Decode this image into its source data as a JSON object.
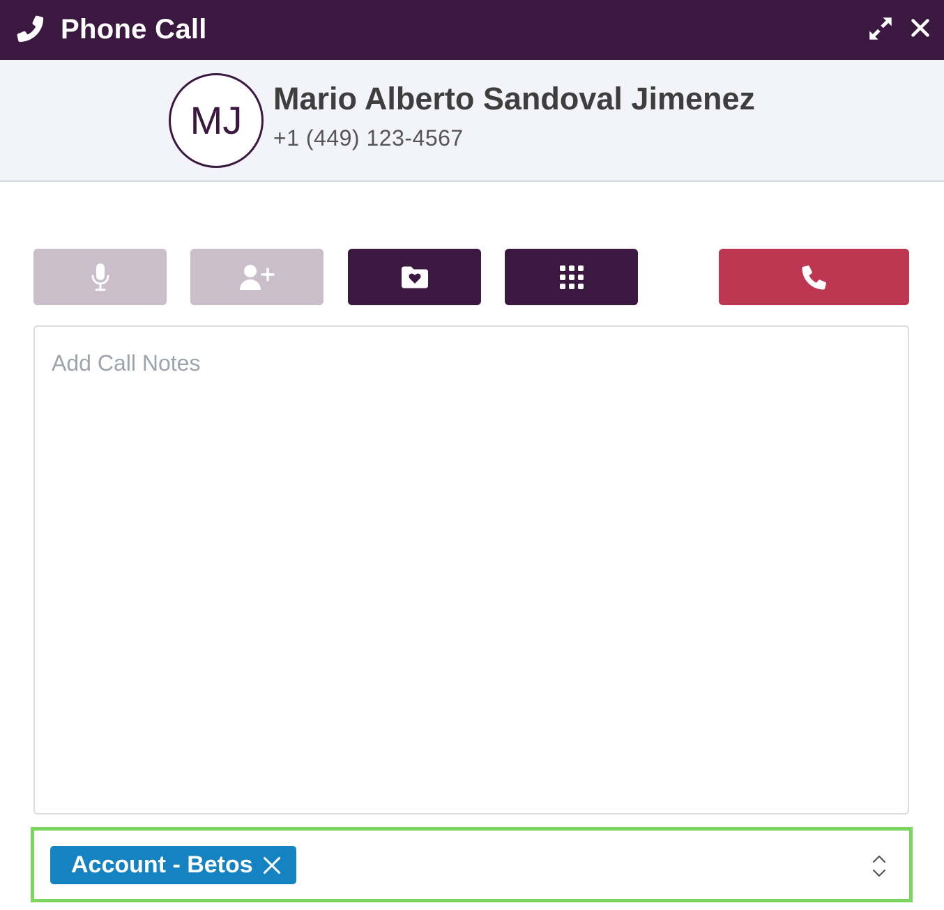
{
  "window": {
    "title": "Phone Call",
    "title_icon": "phone-icon",
    "controls": [
      "expand-icon",
      "close-icon"
    ]
  },
  "contact": {
    "initials": "MJ",
    "name": "Mario Alberto Sandoval Jimenez",
    "phone": "+1 (449) 123-4567"
  },
  "call_controls": [
    {
      "name": "mute",
      "icon": "microphone-icon",
      "state": "disabled"
    },
    {
      "name": "add-participant",
      "icon": "add-user-icon",
      "state": "disabled"
    },
    {
      "name": "save-to-folder",
      "icon": "folder-heart-icon",
      "state": "enabled"
    },
    {
      "name": "keypad",
      "icon": "dialpad-icon",
      "state": "enabled"
    },
    {
      "name": "hang-up",
      "icon": "phone-icon",
      "state": "enabled"
    }
  ],
  "notes": {
    "placeholder": "Add Call Notes",
    "value": ""
  },
  "related": {
    "tags": [
      {
        "label": "Account - Betos"
      }
    ],
    "dropdown_icon": "chevron-up-down-icon"
  },
  "colors": {
    "primary": "#3b1840",
    "disabled": "#c9bec9",
    "danger": "#be3752",
    "tag": "#1583c2",
    "highlight": "#7bd65d",
    "header_bg": "#f3f4f9"
  }
}
